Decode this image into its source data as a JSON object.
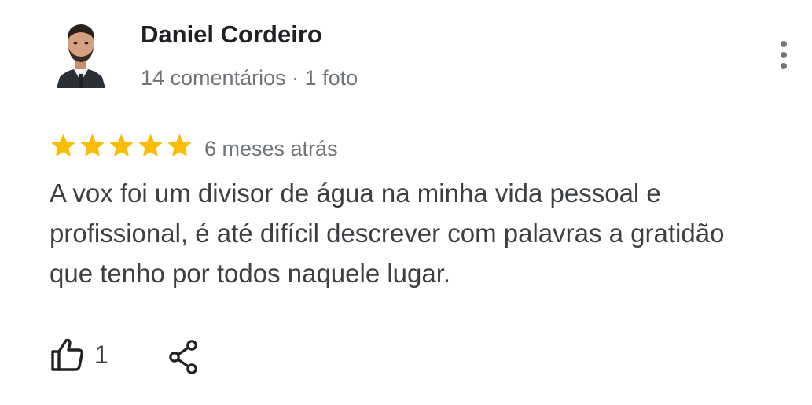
{
  "review": {
    "author": {
      "name": "Daniel Cordeiro",
      "meta": "14 comentários · 1 foto",
      "avatar_icon": "avatar-photo"
    },
    "rating": {
      "stars": 5,
      "max": 5,
      "color": "#fbbc04"
    },
    "date": "6 meses atrás",
    "text": "A vox foi um divisor de água na minha vida pessoal e profissional, é até difícil descrever com palavras a gratidão que tenho por todos naquele lugar.",
    "likes": "1",
    "icons": {
      "more": "more-vert-icon",
      "like": "thumb-up-icon",
      "share": "share-icon",
      "star": "star-icon"
    }
  }
}
